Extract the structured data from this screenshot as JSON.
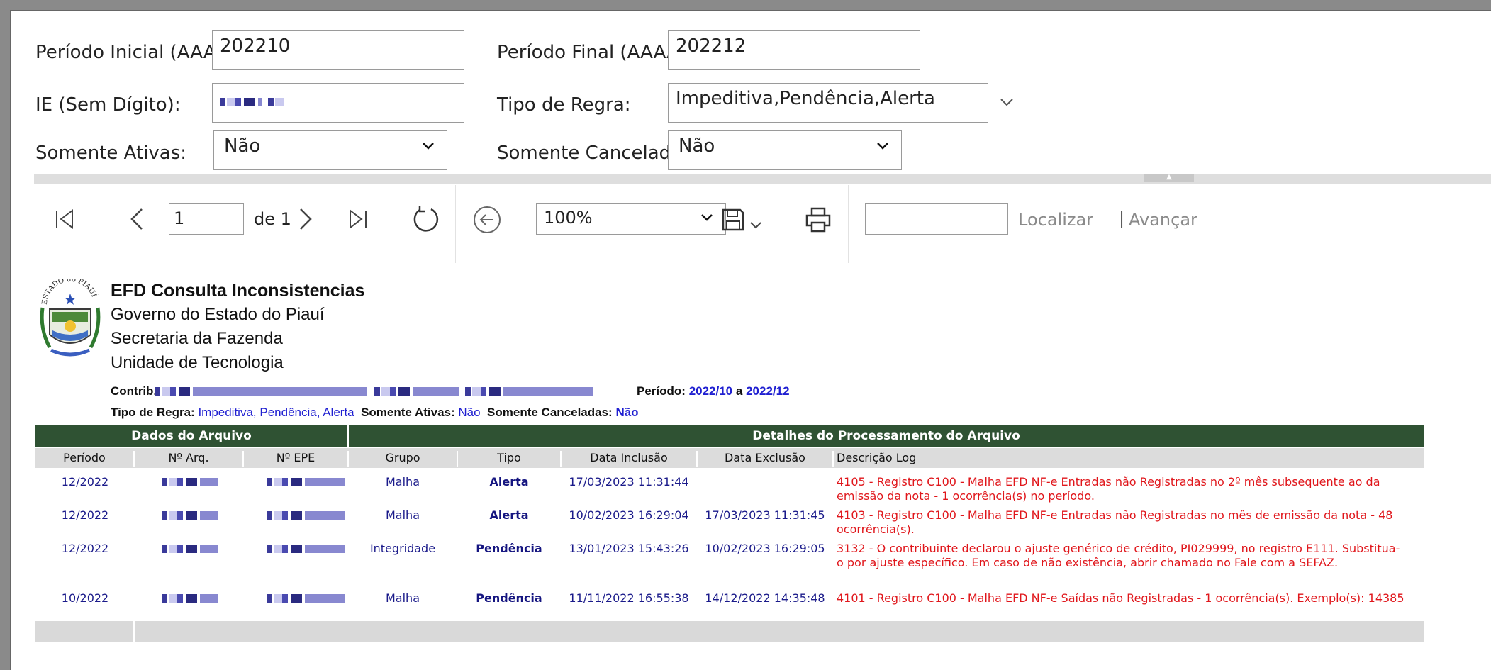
{
  "filters": {
    "periodo_inicial_label": "Período Inicial (AAAAMM):",
    "periodo_inicial_value": "202210",
    "periodo_final_label": "Período Final (AAAAMM):",
    "periodo_final_value": "202212",
    "ie_label": "IE (Sem Dígito):",
    "tipo_regra_label": "Tipo de Regra:",
    "tipo_regra_value": "Impeditiva,Pendência,Alerta",
    "somente_ativas_label": "Somente Ativas:",
    "somente_ativas_value": "Não",
    "somente_canceladas_label": "Somente Canceladas:",
    "somente_canceladas_value": "Não"
  },
  "toolbar": {
    "page_value": "1",
    "page_of": "de 1",
    "zoom_value": "100%",
    "find_label": "Localizar",
    "next_label": "Avançar",
    "separator": "|"
  },
  "report": {
    "title": "EFD Consulta Inconsistencias",
    "line1": "Governo do Estado do Piauí",
    "line2": "Secretaria da Fazenda",
    "line3": "Unidade de Tecnologia",
    "seal_text": "ESTADO do PIAUÍ",
    "contrib_label": "Contrib.:",
    "periodo_label": "Período:",
    "periodo_from": "2022/10",
    "periodo_a": "a",
    "periodo_to": "2022/12",
    "tipo_regra_label": "Tipo de Regra:",
    "tipo_regra_value": "Impeditiva, Pendência, Alerta",
    "somente_ativas_label": "Somente Ativas:",
    "somente_ativas_value": "Não",
    "somente_canceladas_label": "Somente Canceladas:",
    "somente_canceladas_value": "Não"
  },
  "table": {
    "group_headers": [
      "Dados do Arquivo",
      "Detalhes do Processamento do Arquivo"
    ],
    "columns": [
      "Período",
      "Nº Arq.",
      "Nº EPE",
      "Grupo",
      "Tipo",
      "Data Inclusão",
      "Data Exclusão",
      "Descrição Log"
    ],
    "rows": [
      {
        "periodo": "12/2022",
        "grupo": "Malha",
        "tipo": "Alerta",
        "inclusao": "17/03/2023 11:31:44",
        "exclusao": "",
        "log1": "4105 - Registro C100 - Malha EFD NF-e Entradas não Registradas no 2º mês subsequente ao da",
        "log2": "emissão da nota - 1 ocorrência(s) no período."
      },
      {
        "periodo": "12/2022",
        "grupo": "Malha",
        "tipo": "Alerta",
        "inclusao": "10/02/2023 16:29:04",
        "exclusao": "17/03/2023 11:31:45",
        "log1": "4103 - Registro C100 - Malha EFD NF-e Entradas não Registradas no mês de emissão da nota - 48",
        "log2": "ocorrência(s)."
      },
      {
        "periodo": "12/2022",
        "grupo": "Integridade",
        "tipo": "Pendência",
        "inclusao": "13/01/2023 15:43:26",
        "exclusao": "10/02/2023 16:29:05",
        "log1": "3132 - O contribuinte declarou o ajuste genérico de crédito, PI029999, no registro E111. Substitua-",
        "log2": "o por ajuste específico. Em caso de não existência, abrir chamado no Fale com a SEFAZ."
      },
      {
        "periodo": "10/2022",
        "grupo": "Malha",
        "tipo": "Pendência",
        "inclusao": "11/11/2022 16:55:38",
        "exclusao": "14/12/2022 14:35:48",
        "log1": "4101 - Registro C100 - Malha EFD NF-e Saídas não Registradas - 1 ocorrência(s). Exemplo(s): 14385",
        "log2": ""
      }
    ]
  },
  "colors": {
    "header_green": "#2f5233",
    "log_red": "#e0161b",
    "value_blue": "#1f1fd1"
  }
}
